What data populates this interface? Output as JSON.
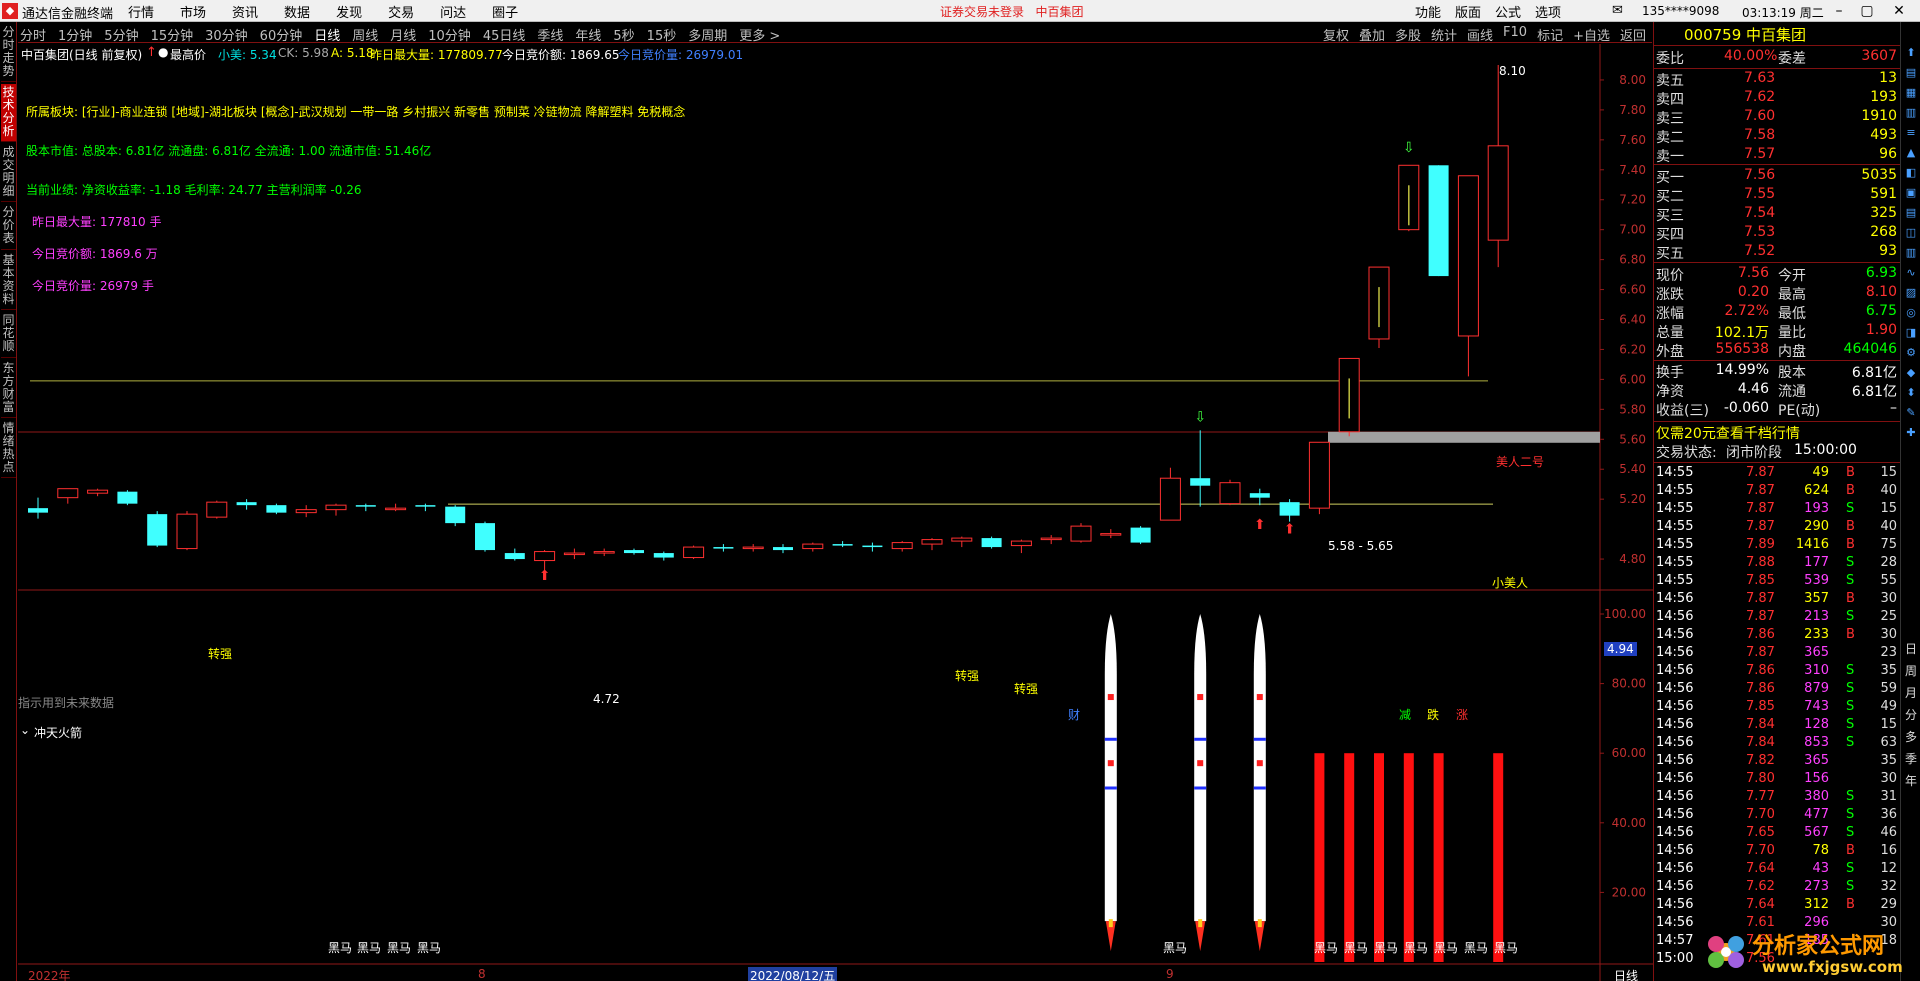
{
  "menubar": {
    "app_title": "通达信金融终端",
    "menus": [
      "行情",
      "市场",
      "资讯",
      "数据",
      "发现",
      "交易",
      "问达",
      "圈子"
    ],
    "warning": "证券交易未登录",
    "stock_name": "中百集团",
    "right_menus": [
      "功能",
      "版面",
      "公式",
      "选项"
    ],
    "account": "135****9098",
    "clock": "03:13:19 周二"
  },
  "left_tabs": [
    "分时走势",
    "技术分析",
    "成交明细",
    "分价表",
    "基本资料",
    "同花顺",
    "东方财富",
    "情绪热点"
  ],
  "periods": [
    "分时",
    "1分钟",
    "5分钟",
    "15分钟",
    "30分钟",
    "60分钟",
    "日线",
    "周线",
    "月线",
    "10分钟",
    "45日线",
    "季线",
    "年线",
    "5秒",
    "15秒",
    "多周期",
    "更多 >"
  ],
  "selected_period": "日线",
  "chart_tools": [
    "复权",
    "叠加",
    "多股",
    "统计",
    "画线",
    "F10",
    "标记",
    "+自选",
    "返回"
  ],
  "chart_header": {
    "name": "中百集团(日线 前复权)",
    "indicator": "最高价",
    "xiaomei": "小美: 5.34",
    "ck": "CK: 5.98",
    "a": "A: 5.18",
    "yesterday_max_vol": "昨日最大量: 177809.77",
    "today_bid_amount": "今日竞价额: 1869.65",
    "today_bid_vol": "今日竞价量: 26979.01"
  },
  "info_text": {
    "sector": "所属板块: [行业]-商业连锁 [地域]-湖北板块 [概念]-武汉规划 一带一路 乡村振兴 新零售 预制菜 冷链物流 降解塑料 免税概念",
    "capital": "股本市值: 总股本: 6.81亿 流通盘: 6.81亿 全流通: 1.00 流通市值: 51.46亿",
    "performance": "当前业绩: 净资收益率: -1.18 毛利率: 24.77 主营利润率 -0.26",
    "y_max_vol": "昨日最大量: 177810 手",
    "t_bid_amount": "今日竞价额: 1869.6 万",
    "t_bid_vol": "今日竞价量: 26979 手",
    "future_note": "指示用到未来数据"
  },
  "annotations": {
    "high_label": "8.10",
    "low_label": "4.72",
    "meiren2": "美人二号",
    "xiaomeiren": "小美人",
    "zone_label": "5.58 - 5.65",
    "price_marker": "4.94",
    "zhuanqiang": "转强",
    "cai": "财",
    "jian": "减",
    "die": "跌",
    "zhang": "涨",
    "heima": "黑马"
  },
  "sub_indicator": {
    "name": "冲天火箭",
    "ticks": [
      "100.00",
      "80.00",
      "60.00",
      "40.00",
      "20.00"
    ]
  },
  "x_axis": {
    "year": "2022年",
    "month8": "8",
    "cursor_date": "2022/08/12/五",
    "month9": "9",
    "period_label": "日线"
  },
  "chart_data": {
    "type": "candlestick",
    "ylim": [
      4.6,
      8.2
    ],
    "yticks": [
      8.0,
      7.8,
      7.6,
      7.4,
      7.2,
      7.0,
      6.8,
      6.6,
      6.4,
      6.2,
      6.0,
      5.8,
      5.6,
      5.4,
      5.2,
      4.8
    ],
    "candles": [
      [
        5.14,
        5.21,
        5.07,
        5.11
      ],
      [
        5.21,
        5.25,
        5.17,
        5.27
      ],
      [
        5.24,
        5.27,
        5.22,
        5.26
      ],
      [
        5.25,
        5.26,
        5.16,
        5.17
      ],
      [
        5.1,
        5.12,
        4.88,
        4.89
      ],
      [
        4.87,
        5.12,
        4.86,
        5.1
      ],
      [
        5.08,
        5.19,
        5.07,
        5.18
      ],
      [
        5.18,
        5.2,
        5.13,
        5.16
      ],
      [
        5.16,
        5.17,
        5.1,
        5.11
      ],
      [
        5.11,
        5.16,
        5.08,
        5.13
      ],
      [
        5.13,
        5.17,
        5.09,
        5.16
      ],
      [
        5.16,
        5.17,
        5.12,
        5.15
      ],
      [
        5.14,
        5.17,
        5.12,
        5.14
      ],
      [
        5.16,
        5.17,
        5.12,
        5.15
      ],
      [
        5.15,
        5.16,
        5.02,
        5.04
      ],
      [
        5.04,
        5.05,
        4.85,
        4.86
      ],
      [
        4.84,
        4.87,
        4.79,
        4.8
      ],
      [
        4.79,
        4.86,
        4.72,
        4.85
      ],
      [
        4.84,
        4.87,
        4.8,
        4.84
      ],
      [
        4.85,
        4.87,
        4.82,
        4.85
      ],
      [
        4.86,
        4.87,
        4.83,
        4.84
      ],
      [
        4.84,
        4.85,
        4.79,
        4.81
      ],
      [
        4.81,
        4.89,
        4.8,
        4.88
      ],
      [
        4.88,
        4.9,
        4.85,
        4.87
      ],
      [
        4.87,
        4.9,
        4.85,
        4.88
      ],
      [
        4.88,
        4.9,
        4.84,
        4.86
      ],
      [
        4.87,
        4.91,
        4.85,
        4.9
      ],
      [
        4.9,
        4.92,
        4.88,
        4.89
      ],
      [
        4.89,
        4.91,
        4.85,
        4.88
      ],
      [
        4.87,
        4.92,
        4.85,
        4.91
      ],
      [
        4.9,
        4.94,
        4.86,
        4.93
      ],
      [
        4.92,
        4.95,
        4.88,
        4.94
      ],
      [
        4.94,
        4.95,
        4.87,
        4.88
      ],
      [
        4.89,
        4.93,
        4.84,
        4.92
      ],
      [
        4.93,
        4.96,
        4.9,
        4.94
      ],
      [
        4.92,
        5.04,
        4.91,
        5.02
      ],
      [
        4.96,
        5.0,
        4.94,
        4.97
      ],
      [
        5.01,
        5.02,
        4.9,
        4.91
      ],
      [
        5.06,
        5.41,
        5.06,
        5.34
      ],
      [
        5.34,
        5.66,
        5.15,
        5.29
      ],
      [
        5.17,
        5.33,
        5.16,
        5.31
      ],
      [
        5.24,
        5.27,
        5.16,
        5.21
      ],
      [
        5.18,
        5.2,
        5.05,
        5.09
      ],
      [
        5.14,
        5.58,
        5.1,
        5.58
      ],
      [
        5.65,
        6.14,
        5.62,
        6.14
      ],
      [
        6.27,
        6.75,
        6.21,
        6.75
      ],
      [
        7.0,
        7.43,
        6.99,
        7.43
      ],
      [
        7.43,
        7.43,
        6.69,
        6.69
      ],
      [
        6.29,
        7.35,
        6.02,
        7.36
      ],
      [
        6.93,
        8.1,
        6.75,
        7.56
      ]
    ],
    "level_lines": {
      "meiren2": 5.99,
      "xiaomeiren": 5.34,
      "ck_line": 5.18
    },
    "rockets_at": [
      36,
      39,
      41
    ],
    "red_bars": {
      "indices": [
        43,
        44,
        45,
        46,
        47,
        49
      ],
      "value": 60
    }
  },
  "quote": {
    "code_name": "000759 中百集团",
    "weibi_label": "委比",
    "weibi": "40.00%",
    "weicha_label": "委差",
    "weicha": "3607",
    "asks": [
      {
        "label": "卖五",
        "price": "7.63",
        "vol": "13"
      },
      {
        "label": "卖四",
        "price": "7.62",
        "vol": "193"
      },
      {
        "label": "卖三",
        "price": "7.60",
        "vol": "1910"
      },
      {
        "label": "卖二",
        "price": "7.58",
        "vol": "493"
      },
      {
        "label": "卖一",
        "price": "7.57",
        "vol": "96"
      }
    ],
    "bids": [
      {
        "label": "买一",
        "price": "7.56",
        "vol": "5035"
      },
      {
        "label": "买二",
        "price": "7.55",
        "vol": "591"
      },
      {
        "label": "买三",
        "price": "7.54",
        "vol": "325"
      },
      {
        "label": "买四",
        "price": "7.53",
        "vol": "268"
      },
      {
        "label": "买五",
        "price": "7.52",
        "vol": "93"
      }
    ],
    "stats": [
      {
        "l1": "现价",
        "v1": "7.56",
        "c1": "#ff3030",
        "l2": "今开",
        "v2": "6.93",
        "c2": "#00ff00"
      },
      {
        "l1": "涨跌",
        "v1": "0.20",
        "c1": "#ff3030",
        "l2": "最高",
        "v2": "8.10",
        "c2": "#ff3030"
      },
      {
        "l1": "涨幅",
        "v1": "2.72%",
        "c1": "#ff3030",
        "l2": "最低",
        "v2": "6.75",
        "c2": "#00ff00"
      },
      {
        "l1": "总量",
        "v1": "102.1万",
        "c1": "#ffff00",
        "l2": "量比",
        "v2": "1.90",
        "c2": "#ff3030"
      },
      {
        "l1": "外盘",
        "v1": "556538",
        "c1": "#ff3030",
        "l2": "内盘",
        "v2": "464046",
        "c2": "#00ff00"
      }
    ],
    "stats2": [
      {
        "l1": "换手",
        "v1": "14.99%",
        "l2": "股本",
        "v2": "6.81亿"
      },
      {
        "l1": "净资",
        "v1": "4.46",
        "l2": "流通",
        "v2": "6.81亿"
      },
      {
        "l1": "收益(三)",
        "v1": "-0.060",
        "l2": "PE(动)",
        "v2": "–"
      }
    ],
    "promo": "仅需20元查看千档行情",
    "trade_status_label": "交易状态:",
    "trade_status": "闭市阶段",
    "trade_time": "15:00:00",
    "ticks": [
      [
        "14:55",
        "7.87",
        "49",
        "B",
        "15"
      ],
      [
        "14:55",
        "7.87",
        "624",
        "B",
        "40"
      ],
      [
        "14:55",
        "7.87",
        "193",
        "S",
        "15"
      ],
      [
        "14:55",
        "7.87",
        "290",
        "B",
        "40"
      ],
      [
        "14:55",
        "7.89",
        "1416",
        "B",
        "75"
      ],
      [
        "14:55",
        "7.88",
        "177",
        "S",
        "28"
      ],
      [
        "14:55",
        "7.85",
        "539",
        "S",
        "55"
      ],
      [
        "14:56",
        "7.87",
        "357",
        "B",
        "30"
      ],
      [
        "14:56",
        "7.87",
        "213",
        "S",
        "25"
      ],
      [
        "14:56",
        "7.86",
        "233",
        "B",
        "30"
      ],
      [
        "14:56",
        "7.87",
        "365",
        "",
        "23"
      ],
      [
        "14:56",
        "7.86",
        "310",
        "S",
        "35"
      ],
      [
        "14:56",
        "7.86",
        "879",
        "S",
        "59"
      ],
      [
        "14:56",
        "7.85",
        "743",
        "S",
        "49"
      ],
      [
        "14:56",
        "7.84",
        "128",
        "S",
        "15"
      ],
      [
        "14:56",
        "7.84",
        "853",
        "S",
        "63"
      ],
      [
        "14:56",
        "7.82",
        "365",
        "",
        "35"
      ],
      [
        "14:56",
        "7.80",
        "156",
        "",
        "30"
      ],
      [
        "14:56",
        "7.77",
        "380",
        "S",
        "31"
      ],
      [
        "14:56",
        "7.70",
        "477",
        "S",
        "36"
      ],
      [
        "14:56",
        "7.65",
        "567",
        "S",
        "46"
      ],
      [
        "14:56",
        "7.70",
        "78",
        "B",
        "16"
      ],
      [
        "14:56",
        "7.64",
        "43",
        "S",
        "12"
      ],
      [
        "14:56",
        "7.62",
        "273",
        "S",
        "32"
      ],
      [
        "14:56",
        "7.64",
        "312",
        "B",
        "29"
      ],
      [
        "14:56",
        "7.61",
        "296",
        "",
        "30"
      ],
      [
        "14:57",
        "7.61",
        "185",
        "",
        "18"
      ],
      [
        "15:00",
        "7.56",
        "",
        "",
        ""
      ]
    ]
  },
  "right_icon_labels": [
    "日",
    "周",
    "月",
    "分",
    "多",
    "季",
    "年"
  ],
  "watermark": {
    "title": "分析家公式网",
    "url": "www.fxjgsw.com"
  }
}
